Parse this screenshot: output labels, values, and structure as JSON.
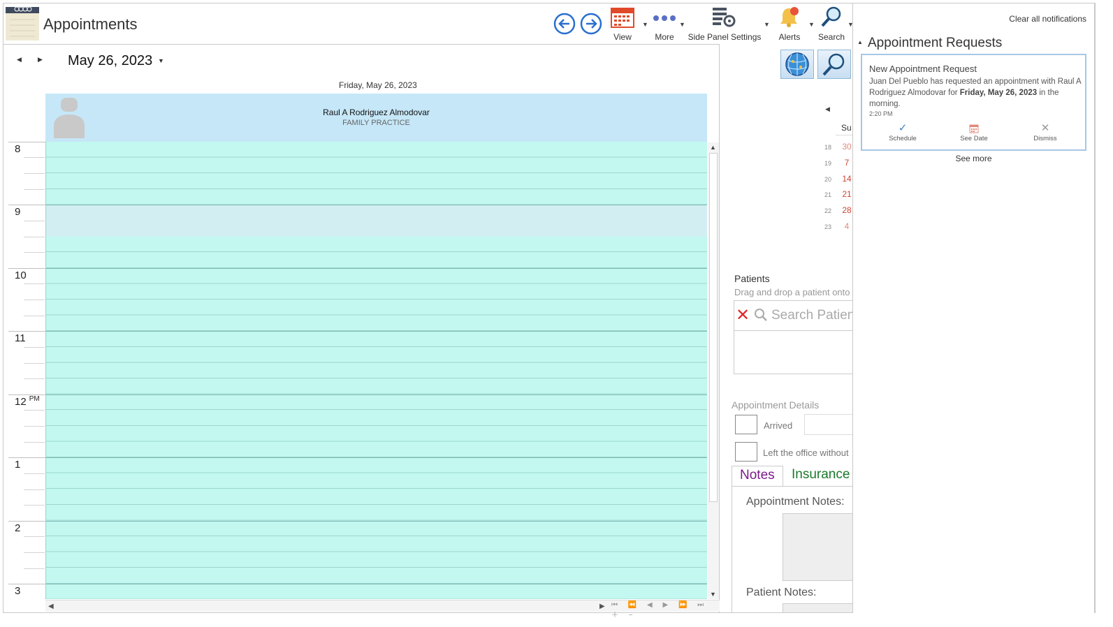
{
  "app": {
    "title": "Appointments"
  },
  "toolbar": {
    "view_label": "View",
    "more_label": "More",
    "side_panel_label": "Side Panel Settings",
    "alerts_label": "Alerts",
    "search_label": "Search"
  },
  "calendar": {
    "current_date": "May 26, 2023",
    "day_label": "Friday, May 26, 2023",
    "resource": {
      "name": "Raul A Rodriguez Almodovar",
      "specialty": "FAMILY PRACTICE"
    },
    "hours": [
      "8",
      "9",
      "10",
      "11",
      "12",
      "1",
      "2",
      "3"
    ],
    "pm_label": "PM"
  },
  "mini_calendar": {
    "day_header": "Su",
    "weeks": [
      {
        "week": "18",
        "day": "30"
      },
      {
        "week": "19",
        "day": "7"
      },
      {
        "week": "20",
        "day": "14"
      },
      {
        "week": "21",
        "day": "21"
      },
      {
        "week": "22",
        "day": "28"
      },
      {
        "week": "23",
        "day": "4"
      }
    ]
  },
  "patients": {
    "title": "Patients",
    "hint": "Drag and drop a patient onto",
    "search_placeholder": "Search Patient"
  },
  "details": {
    "title": "Appointment Details",
    "arrived_label": "Arrived",
    "left_label": "Left the office without",
    "tabs": [
      "Notes",
      "Insurance"
    ],
    "appointment_notes_label": "Appointment Notes:",
    "patient_notes_label": "Patient Notes:"
  },
  "notifications": {
    "clear_all": "Clear all notifications",
    "section_title": "Appointment Requests",
    "card": {
      "title": "New Appointment Request",
      "body_prefix": "Juan  Del Pueblo  has requested an appointment with Raul A Rodriguez Almodovar for ",
      "body_date": "Friday, May 26, 2023",
      "body_suffix": " in the morning.",
      "time": "2:20 PM",
      "actions": [
        "Schedule",
        "See Date",
        "Dismiss"
      ]
    },
    "see_more": "See more"
  },
  "colors": {
    "grid_fill": "#c2f8ef",
    "resource_header": "#c6e7f8",
    "tab_notes": "#7a1b8a",
    "tab_insurance": "#1b7a2a",
    "calendar_red": "#c43"
  }
}
